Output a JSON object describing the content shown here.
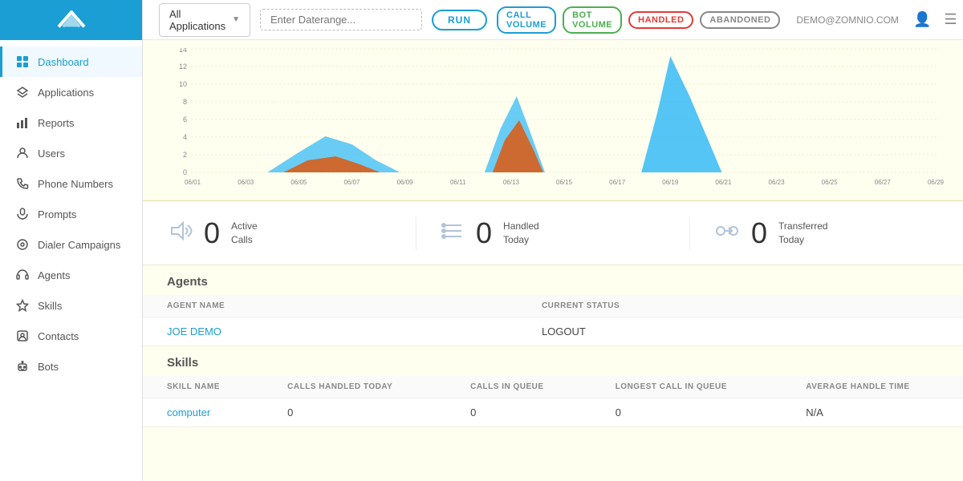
{
  "sidebar": {
    "logo_alt": "Zomnio logo",
    "items": [
      {
        "id": "dashboard",
        "label": "Dashboard",
        "icon": "grid",
        "active": true
      },
      {
        "id": "applications",
        "label": "Applications",
        "icon": "layers",
        "active": false
      },
      {
        "id": "reports",
        "label": "Reports",
        "icon": "bar-chart",
        "active": false
      },
      {
        "id": "users",
        "label": "Users",
        "icon": "user",
        "active": false
      },
      {
        "id": "phone-numbers",
        "label": "Phone Numbers",
        "icon": "phone",
        "active": false
      },
      {
        "id": "prompts",
        "label": "Prompts",
        "icon": "mic",
        "active": false
      },
      {
        "id": "dialer-campaigns",
        "label": "Dialer Campaigns",
        "icon": "dial",
        "active": false
      },
      {
        "id": "agents",
        "label": "Agents",
        "icon": "headset",
        "active": false
      },
      {
        "id": "skills",
        "label": "Skills",
        "icon": "star",
        "active": false
      },
      {
        "id": "contacts",
        "label": "Contacts",
        "icon": "contact",
        "active": false
      },
      {
        "id": "bots",
        "label": "Bots",
        "icon": "bot",
        "active": false
      }
    ]
  },
  "header": {
    "app_selector_label": "All Applications",
    "date_placeholder": "Enter Daterange...",
    "run_button": "RUN",
    "user_email": "DEMO@ZOMNIO.COM",
    "legend": [
      {
        "key": "call-volume",
        "label": "CALL VOLUME"
      },
      {
        "key": "bot-volume",
        "label": "BOT VOLUME"
      },
      {
        "key": "handled",
        "label": "HANDLED"
      },
      {
        "key": "abandoned",
        "label": "ABANDONED"
      }
    ]
  },
  "chart": {
    "x_labels": [
      "06/01",
      "06/03",
      "06/05",
      "06/07",
      "06/09",
      "06/11",
      "06/13",
      "06/15",
      "06/17",
      "06/19",
      "06/21",
      "06/23",
      "06/25",
      "06/27",
      "06/29"
    ],
    "y_labels": [
      "0",
      "2",
      "4",
      "6",
      "8",
      "10",
      "12",
      "14"
    ],
    "y_max": 14
  },
  "stats": [
    {
      "icon": "volume",
      "number": "0",
      "label": "Active\nCalls"
    },
    {
      "icon": "list",
      "number": "0",
      "label": "Handled\nToday"
    },
    {
      "icon": "transfer",
      "number": "0",
      "label": "Transferred\nToday"
    }
  ],
  "agents_section": {
    "title": "Agents",
    "columns": [
      "AGENT NAME",
      "CURRENT STATUS"
    ],
    "rows": [
      {
        "agent_name": "JOE DEMO",
        "status": "LOGOUT"
      }
    ]
  },
  "skills_section": {
    "title": "Skills",
    "columns": [
      "SKILL NAME",
      "CALLS HANDLED TODAY",
      "CALLS IN QUEUE",
      "LONGEST CALL IN QUEUE",
      "AVERAGE HANDLE TIME"
    ],
    "rows": [
      {
        "skill_name": "computer",
        "calls_handled": "0",
        "calls_queue": "0",
        "longest_call": "0",
        "avg_handle": "N/A"
      }
    ]
  }
}
